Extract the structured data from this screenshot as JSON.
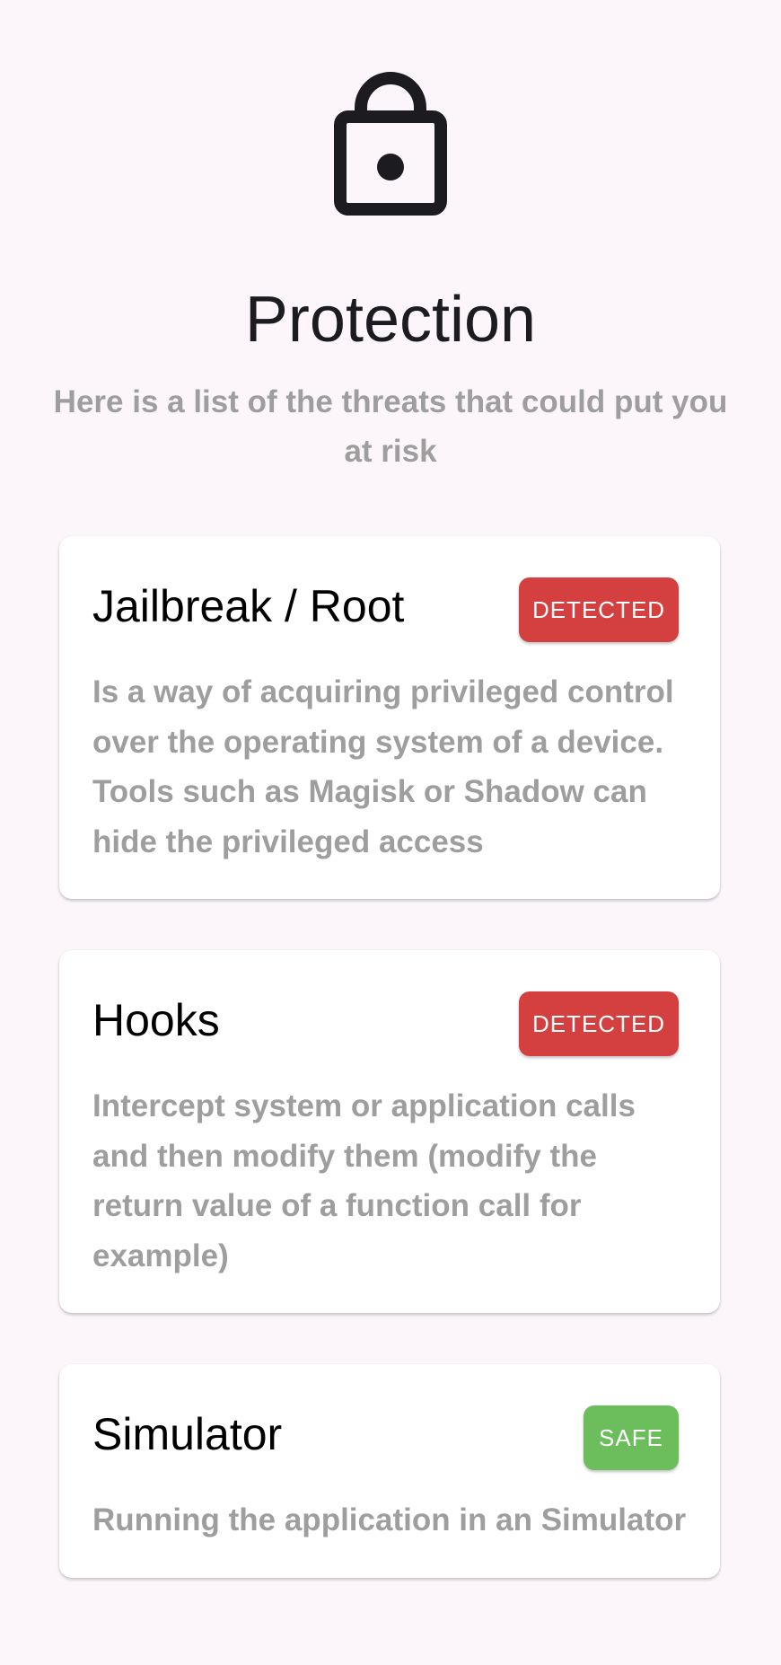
{
  "header": {
    "icon": "lock-open-icon",
    "title": "Protection",
    "subtitle": "Here is a list of the threats that could put you at risk"
  },
  "threats": [
    {
      "title": "Jailbreak / Root",
      "status": "DETECTED",
      "status_color": "#d44040",
      "description": "Is a way of acquiring privileged control over the operating system of a device. Tools such as Magisk or Shadow can hide the privileged access"
    },
    {
      "title": "Hooks",
      "status": "DETECTED",
      "status_color": "#d44040",
      "description": "Intercept system or application calls and then modify them (modify the return value of a function call for example)"
    },
    {
      "title": "Simulator",
      "status": "SAFE",
      "status_color": "#6cbd5b",
      "description": "Running the application in an Simulator"
    }
  ],
  "colors": {
    "background": "#fcf6fb",
    "card": "#ffffff",
    "muted_text": "#9e9e9e",
    "detected": "#d44040",
    "safe": "#6cbd5b"
  }
}
